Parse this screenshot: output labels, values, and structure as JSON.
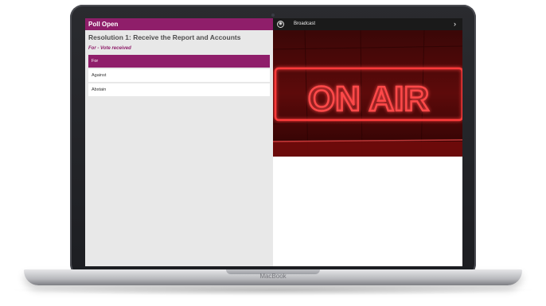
{
  "device": {
    "brand": "MacBook"
  },
  "poll": {
    "header": "Poll Open",
    "resolution_title": "Resolution 1: Receive the Report and Accounts",
    "vote_status": "For - Vote received",
    "options": [
      {
        "label": "For",
        "selected": true
      },
      {
        "label": "Against",
        "selected": false
      },
      {
        "label": "Abstain",
        "selected": false
      }
    ]
  },
  "broadcast": {
    "label": "Broadcast",
    "sign_text": "ON AIR",
    "icon": "broadcast-icon",
    "chevron_icon": "chevron-right-icon"
  },
  "colors": {
    "accent": "#8f1e6a",
    "bar": "#1a1a1a",
    "sign_red": "#ff3b3b"
  }
}
